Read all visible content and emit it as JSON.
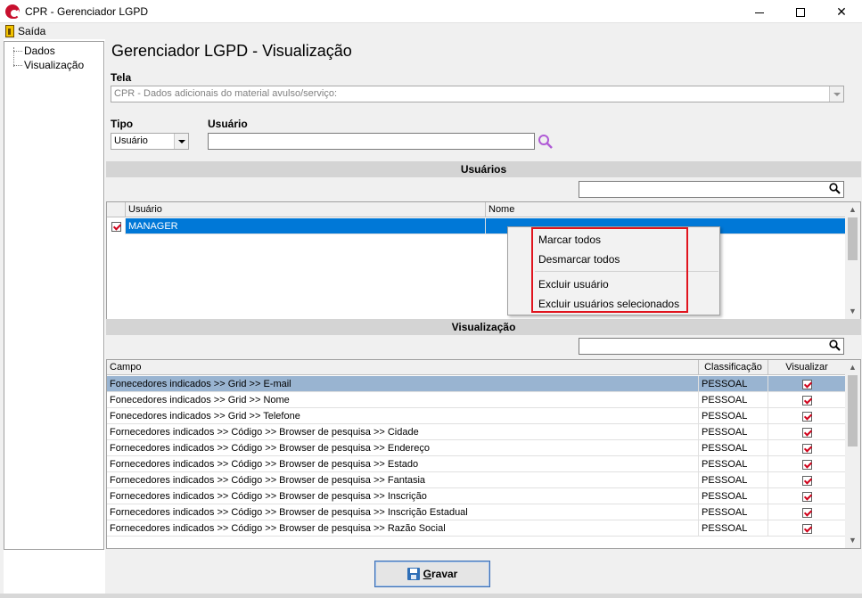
{
  "window": {
    "title": "CPR - Gerenciador LGPD",
    "minimize": "minimize",
    "maximize": "maximize",
    "close": "✕"
  },
  "menu": {
    "exit_label": "Saída"
  },
  "tree": {
    "items": [
      "Dados",
      "Visualização"
    ]
  },
  "page": {
    "title": "Gerenciador LGPD - Visualização"
  },
  "tela": {
    "label": "Tela",
    "value": "CPR - Dados adicionais do material avulso/serviço:"
  },
  "tipo": {
    "label": "Tipo",
    "value": "Usuário"
  },
  "usuario_field": {
    "label": "Usuário",
    "value": ""
  },
  "usuarios_section": {
    "header": "Usuários",
    "columns": [
      "Usuário",
      "Nome"
    ],
    "rows": [
      {
        "checked": true,
        "usuario": "MANAGER",
        "nome": ""
      }
    ]
  },
  "context_menu": {
    "items": [
      "Marcar todos",
      "Desmarcar todos",
      "Excluir usuário",
      "Excluir usuários selecionados"
    ]
  },
  "visualizacao_section": {
    "header": "Visualização",
    "columns": [
      "Campo",
      "Classificação",
      "Visualizar"
    ],
    "rows": [
      {
        "campo": "Fonecedores indicados >> Grid >> E-mail",
        "classificacao": "PESSOAL",
        "visualizar": true
      },
      {
        "campo": "Fonecedores indicados >> Grid >> Nome",
        "classificacao": "PESSOAL",
        "visualizar": true
      },
      {
        "campo": "Fonecedores indicados >> Grid >> Telefone",
        "classificacao": "PESSOAL",
        "visualizar": true
      },
      {
        "campo": "Fornecedores indicados >> Código >> Browser de pesquisa >> Cidade",
        "classificacao": "PESSOAL",
        "visualizar": true
      },
      {
        "campo": "Fornecedores indicados >> Código >> Browser de pesquisa >> Endereço",
        "classificacao": "PESSOAL",
        "visualizar": true
      },
      {
        "campo": "Fornecedores indicados >> Código >> Browser de pesquisa >> Estado",
        "classificacao": "PESSOAL",
        "visualizar": true
      },
      {
        "campo": "Fornecedores indicados >> Código >> Browser de pesquisa >> Fantasia",
        "classificacao": "PESSOAL",
        "visualizar": true
      },
      {
        "campo": "Fornecedores indicados >> Código >> Browser de pesquisa >> Inscrição",
        "classificacao": "PESSOAL",
        "visualizar": true
      },
      {
        "campo": "Fornecedores indicados >> Código >> Browser de pesquisa >> Inscrição Estadual",
        "classificacao": "PESSOAL",
        "visualizar": true
      },
      {
        "campo": "Fornecedores indicados >> Código >> Browser de pesquisa >> Razão Social",
        "classificacao": "PESSOAL",
        "visualizar": true
      }
    ]
  },
  "save_button": {
    "accel": "G",
    "rest": "ravar"
  },
  "colors": {
    "selection_blue": "#0078d7",
    "selection_light": "#99b4d1",
    "highlight_red": "#e0141e",
    "check_red": "#d0021b"
  }
}
